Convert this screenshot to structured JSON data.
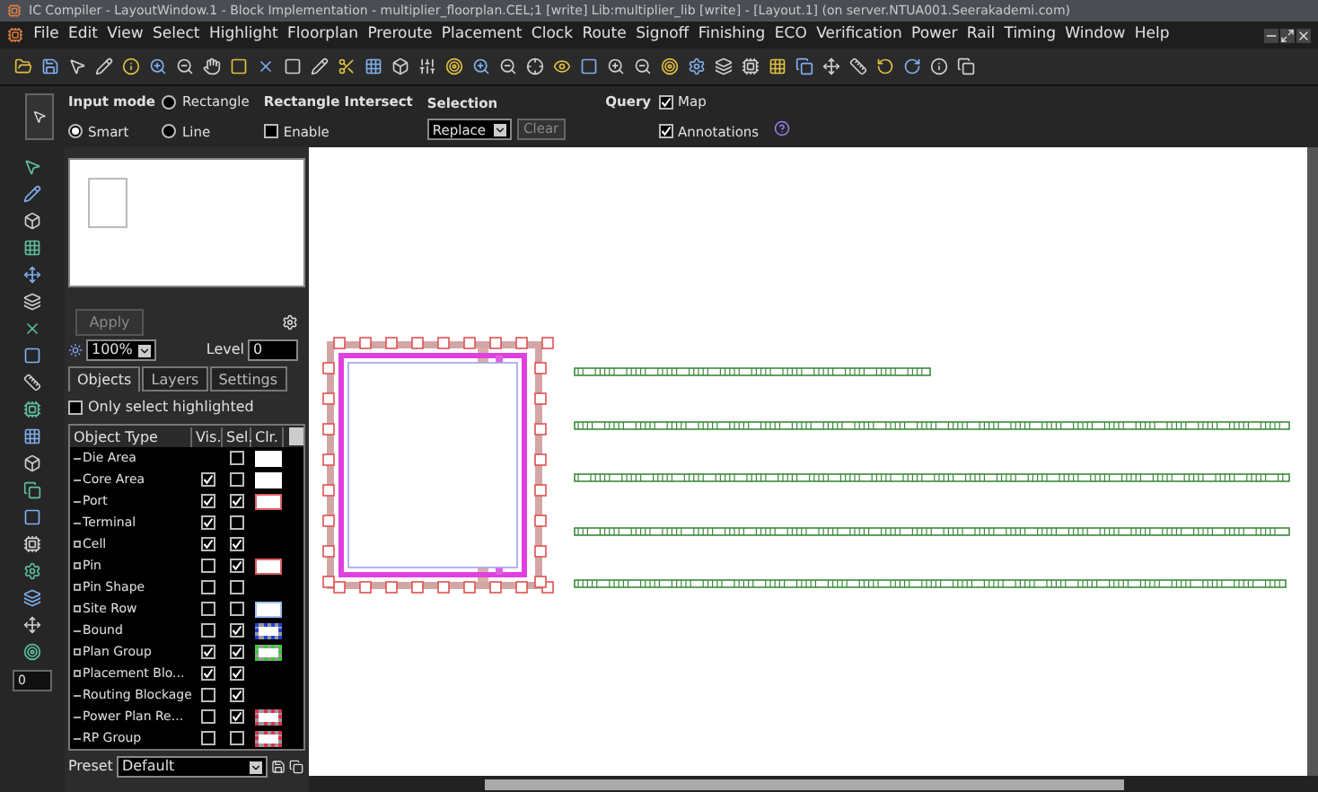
{
  "window": {
    "title": "IC Compiler - LayoutWindow.1 - Block Implementation - multiplier_floorplan.CEL;1 [write]   Lib:multiplier_lib [write] - [Layout.1] (on server.NTUA001.Seerakademi.com)"
  },
  "menu": [
    "File",
    "Edit",
    "View",
    "Select",
    "Highlight",
    "Floorplan",
    "Preroute",
    "Placement",
    "Clock",
    "Route",
    "Signoff",
    "Finishing",
    "ECO",
    "Verification",
    "Power",
    "Rail",
    "Timing",
    "Window",
    "Help"
  ],
  "options": {
    "input_mode": {
      "label": "Input mode",
      "choices": [
        {
          "label": "Rectangle",
          "selected": false
        },
        {
          "label": "Smart",
          "selected": true
        },
        {
          "label": "Line",
          "selected": false
        }
      ]
    },
    "rectangle_intersect": {
      "label": "Rectangle Intersect",
      "enable": {
        "label": "Enable",
        "checked": false
      }
    },
    "selection": {
      "label": "Selection",
      "mode": "Replace",
      "clear": "Clear"
    },
    "query": {
      "label": "Query",
      "map": {
        "label": "Map",
        "checked": true
      },
      "annotations": {
        "label": "Annotations",
        "checked": true
      }
    }
  },
  "panel": {
    "apply": "Apply",
    "zoom": "100%",
    "level_label": "Level",
    "level": "0",
    "tabs": [
      {
        "label": "Objects",
        "selected": true
      },
      {
        "label": "Layers",
        "selected": false
      },
      {
        "label": "Settings",
        "selected": false
      }
    ],
    "only_selected": {
      "label": "Only select highlighted",
      "checked": false
    },
    "columns": [
      "Object Type",
      "Vis.",
      "Sel.",
      "Clr."
    ],
    "rows": [
      {
        "name": "Die Area",
        "expandable": false,
        "sel": false,
        "color": "#ffffff",
        "dotted": false
      },
      {
        "name": "Core Area",
        "expandable": false,
        "vis": true,
        "sel": false,
        "color": "#ffffff",
        "dotted": false
      },
      {
        "name": "Port",
        "expandable": false,
        "vis": true,
        "sel": true,
        "color": "#e06060",
        "dotted": false
      },
      {
        "name": "Terminal",
        "expandable": false,
        "vis": true,
        "sel": false
      },
      {
        "name": "Cell",
        "expandable": true,
        "vis": true,
        "sel": true
      },
      {
        "name": "Pin",
        "expandable": true,
        "vis": false,
        "sel": true,
        "color": "#e06060",
        "dotted": false
      },
      {
        "name": "Pin Shape",
        "expandable": true,
        "vis": false,
        "sel": false
      },
      {
        "name": "Site Row",
        "expandable": true,
        "vis": false,
        "sel": false,
        "color": "#a0c0f0",
        "dotted": false
      },
      {
        "name": "Bound",
        "expandable": false,
        "vis": false,
        "sel": true,
        "color": "#2040e0",
        "dotted": true
      },
      {
        "name": "Plan Group",
        "expandable": true,
        "vis": true,
        "sel": true,
        "color": "#30d030",
        "dotted": true
      },
      {
        "name": "Placement Blo...",
        "expandable": true,
        "vis": true,
        "sel": true
      },
      {
        "name": "Routing Blockage",
        "expandable": false,
        "vis": false,
        "sel": true
      },
      {
        "name": "Power Plan Re...",
        "expandable": false,
        "vis": false,
        "sel": true,
        "color": "#e03050",
        "dotted": true
      },
      {
        "name": "RP Group",
        "expandable": false,
        "vis": false,
        "sel": false,
        "color": "#e03050",
        "dotted": true
      }
    ],
    "preset_label": "Preset",
    "preset": "Default"
  },
  "side_field": "0"
}
